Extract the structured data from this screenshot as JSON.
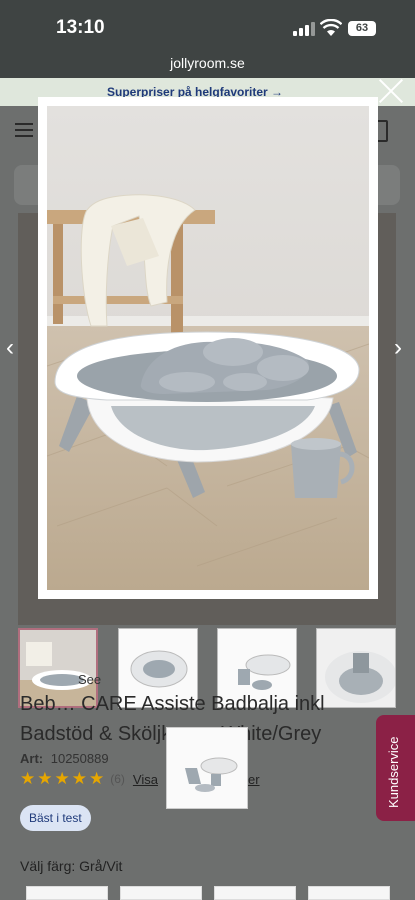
{
  "status_bar": {
    "time": "13:10",
    "battery": "63"
  },
  "browser": {
    "url": "jollyroom.se"
  },
  "promo": {
    "text": "Superpriser på helgfavoriter →"
  },
  "product": {
    "brand_fragment": "See",
    "title_line1": "Beb… CARE Assiste Badbalja inkl",
    "title_line2": "Badstöd & Sköljkanna White/Grey",
    "art_label": "Art:",
    "art_number": "10250889",
    "rating": 5,
    "review_count": "(6)",
    "visa_label": "Visa",
    "visa_suffix": "er",
    "badge": "Bäst i test",
    "color_label": "Välj färg: Grå/Vit"
  },
  "floating": {
    "kundservice": "Kundservice"
  },
  "icons": [
    "signal-icon",
    "wifi-icon",
    "battery-icon",
    "close-icon",
    "menu-icon",
    "cart-icon",
    "chevron-left-icon",
    "chevron-right-icon",
    "star-icon"
  ],
  "colors": {
    "accent": "#8b2146",
    "promo_bg": "#dfe7dc",
    "star": "#e6a600",
    "badge_bg": "#dbe4f4"
  }
}
